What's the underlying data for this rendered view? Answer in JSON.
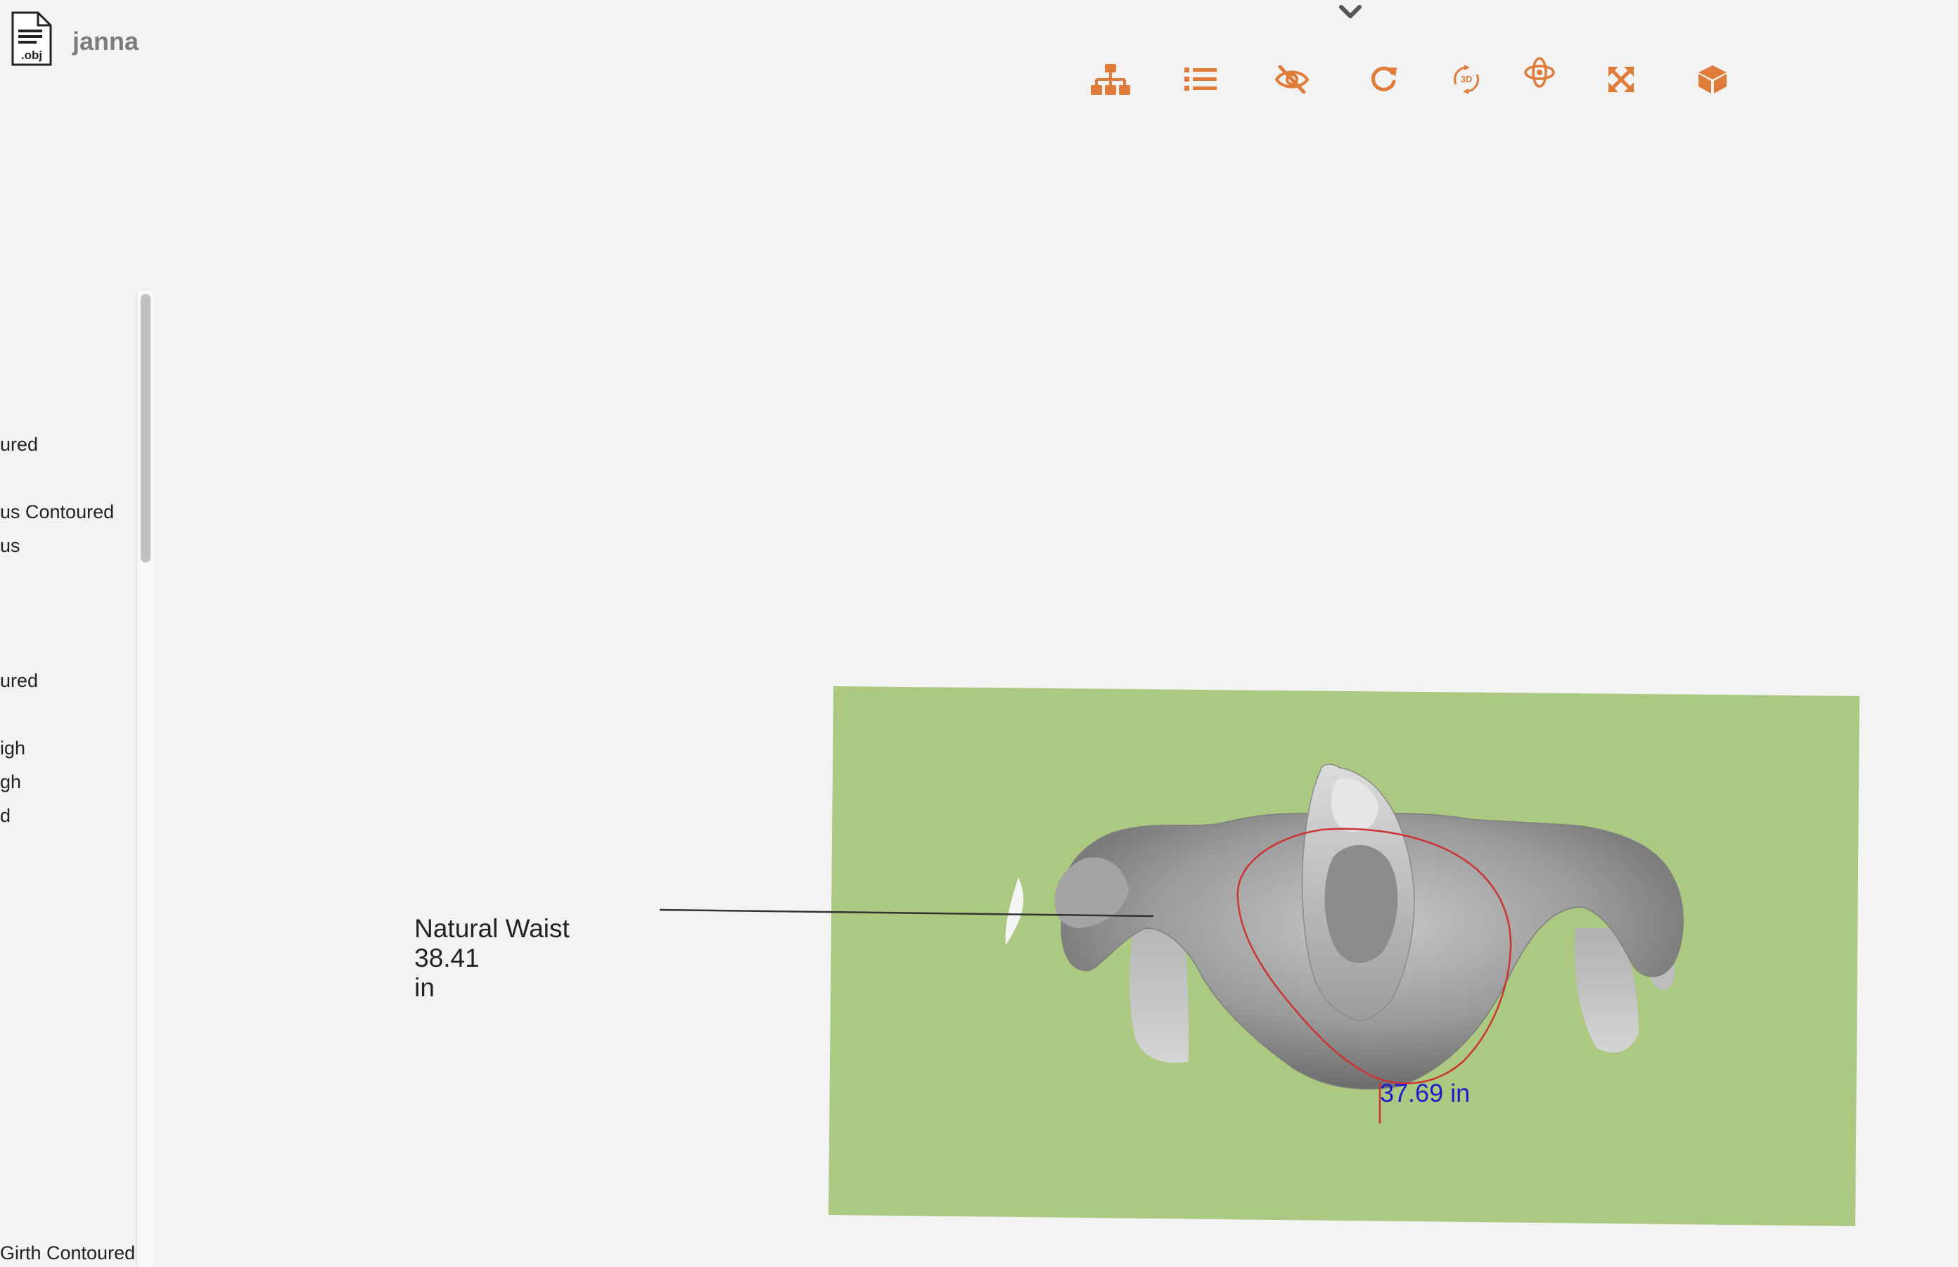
{
  "header": {
    "file_badge": ".obj",
    "title": "janna"
  },
  "toolbar": {
    "buttons": [
      {
        "name": "hierarchy",
        "icon": "sitemap-icon"
      },
      {
        "name": "list",
        "icon": "list-icon"
      },
      {
        "name": "hide",
        "icon": "eye-slash-icon"
      },
      {
        "name": "reset",
        "icon": "redo-icon"
      },
      {
        "name": "rotate-3d",
        "icon": "rotate-3d-icon"
      },
      {
        "name": "orbit",
        "icon": "orbit-icon"
      },
      {
        "name": "fullscreen",
        "icon": "expand-icon"
      },
      {
        "name": "model",
        "icon": "cube-icon"
      }
    ],
    "accent_color": "#e07b39"
  },
  "side_panel": {
    "items": [
      {
        "label": "ured"
      },
      {
        "label": "us Contoured"
      },
      {
        "label": "us"
      },
      {
        "label": "ured"
      },
      {
        "label": "igh"
      },
      {
        "label": "gh"
      },
      {
        "label": "d"
      },
      {
        "label": "Girth Contoured"
      }
    ]
  },
  "viewport": {
    "measurement_name": "Natural Waist",
    "measurement_value": "38.41",
    "measurement_unit": "in",
    "contour_value": "37.69 in",
    "plane_color": "#abc981",
    "contour_color": "#cc3333",
    "label_color": "#1c1ccc"
  }
}
